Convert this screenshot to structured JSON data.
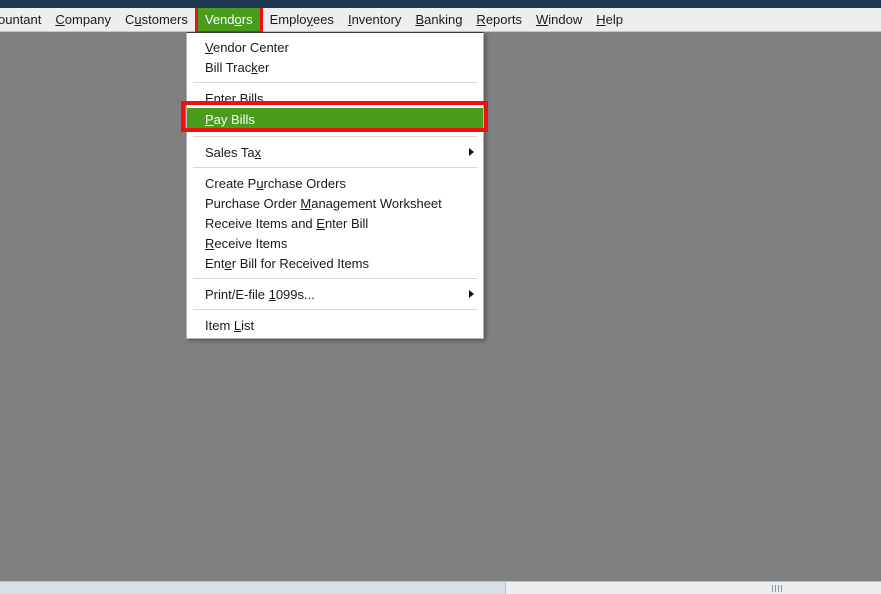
{
  "window": {
    "titlebar_color": "#1d3650",
    "workspace_color": "#808080"
  },
  "menubar": {
    "items": [
      {
        "label": "ountant",
        "mnemonic_index": -1,
        "clipped": true,
        "selected": false
      },
      {
        "label": "Company",
        "mnemonic_index": 0,
        "clipped": false,
        "selected": false
      },
      {
        "label": "Customers",
        "mnemonic_index": 1,
        "clipped": false,
        "selected": false
      },
      {
        "label": "Vendors",
        "mnemonic_index": 4,
        "clipped": false,
        "selected": true
      },
      {
        "label": "Employees",
        "mnemonic_index": 5,
        "clipped": false,
        "selected": false
      },
      {
        "label": "Inventory",
        "mnemonic_index": 0,
        "clipped": false,
        "selected": false
      },
      {
        "label": "Banking",
        "mnemonic_index": 0,
        "clipped": false,
        "selected": false
      },
      {
        "label": "Reports",
        "mnemonic_index": 0,
        "clipped": false,
        "selected": false
      },
      {
        "label": "Window",
        "mnemonic_index": 0,
        "clipped": false,
        "selected": false
      },
      {
        "label": "Help",
        "mnemonic_index": 0,
        "clipped": false,
        "selected": false
      }
    ],
    "selected_color": "#4a9c1c",
    "selected_outline_color": "#ee1111"
  },
  "dropdown": {
    "owner": "Vendors",
    "highlight_color": "#4a9c1c",
    "annotation_color": "#ee1111",
    "groups": [
      {
        "items": [
          {
            "label": "Vendor Center",
            "mnemonic_index": 0,
            "submenu": false,
            "highlighted": false
          },
          {
            "label": "Bill Tracker",
            "mnemonic_index": 9,
            "submenu": false,
            "highlighted": false
          }
        ]
      },
      {
        "items": [
          {
            "label": "Enter Bills",
            "mnemonic_index": 0,
            "submenu": false,
            "highlighted": false
          },
          {
            "label": "Pay Bills",
            "mnemonic_index": 0,
            "submenu": false,
            "highlighted": true
          }
        ]
      },
      {
        "items": [
          {
            "label": "Sales Tax",
            "mnemonic_index": 8,
            "submenu": true,
            "highlighted": false
          }
        ]
      },
      {
        "items": [
          {
            "label": "Create Purchase Orders",
            "mnemonic_index": 8,
            "submenu": false,
            "highlighted": false
          },
          {
            "label": "Purchase Order Management Worksheet",
            "mnemonic_index": 15,
            "submenu": false,
            "highlighted": false
          },
          {
            "label": "Receive Items and Enter Bill",
            "mnemonic_index": 18,
            "submenu": false,
            "highlighted": false
          },
          {
            "label": "Receive Items",
            "mnemonic_index": 0,
            "submenu": false,
            "highlighted": false
          },
          {
            "label": "Enter Bill for Received Items",
            "mnemonic_index": 3,
            "submenu": false,
            "highlighted": false
          }
        ]
      },
      {
        "items": [
          {
            "label": "Print/E-file 1099s...",
            "mnemonic_index": 13,
            "submenu": true,
            "highlighted": false
          }
        ]
      },
      {
        "items": [
          {
            "label": "Item List",
            "mnemonic_index": 5,
            "submenu": false,
            "highlighted": false
          }
        ]
      }
    ]
  },
  "statusbar": {
    "left_panel_text": "",
    "right_panel_text": "",
    "grip_marks": 4
  }
}
